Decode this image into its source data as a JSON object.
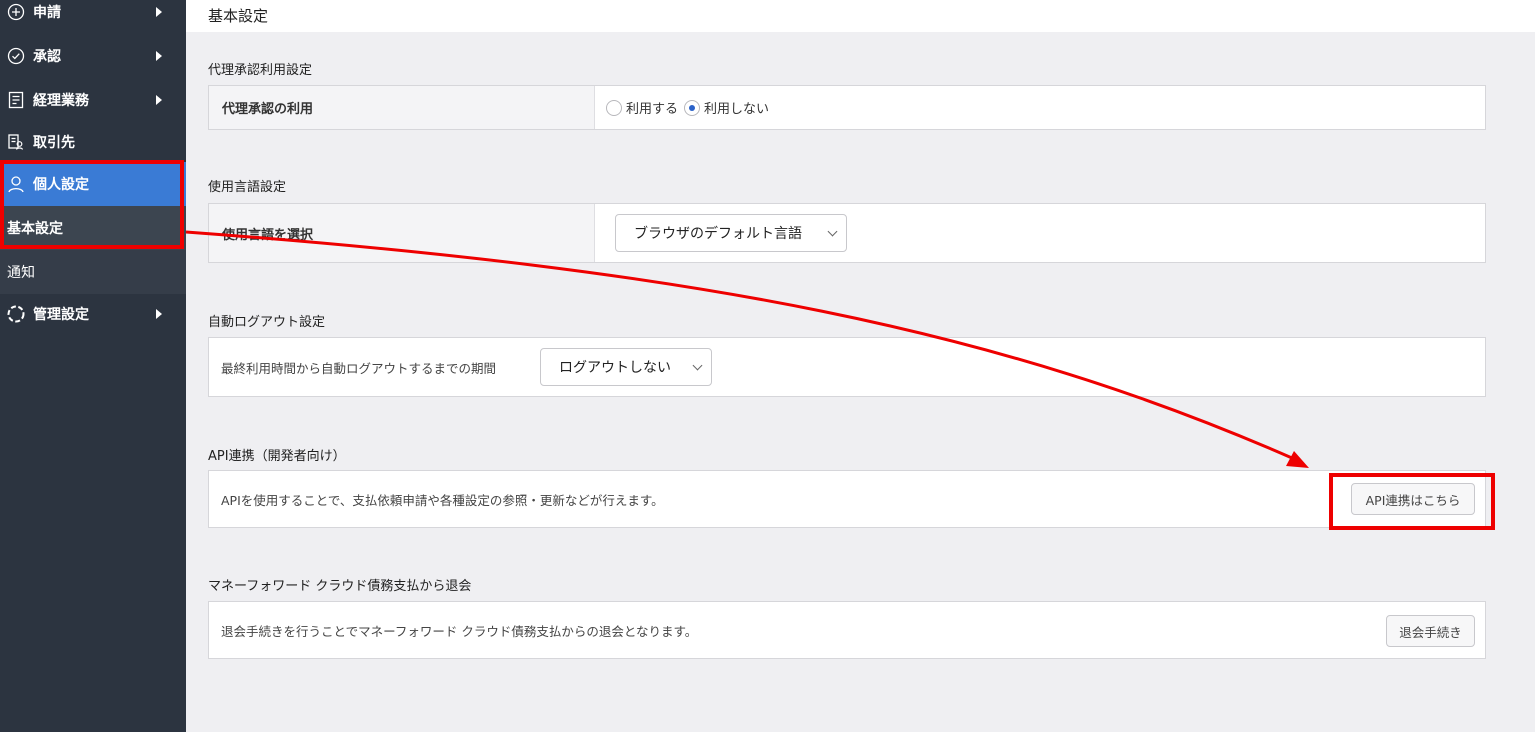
{
  "sidebar": {
    "items": [
      {
        "label": "申請",
        "icon": "plus-circle-icon"
      },
      {
        "label": "承認",
        "icon": "check-circle-icon"
      },
      {
        "label": "経理業務",
        "icon": "document-list-icon"
      },
      {
        "label": "取引先",
        "icon": "vendor-icon"
      },
      {
        "label": "個人設定",
        "icon": "user-icon"
      },
      {
        "label": "管理設定",
        "icon": "gear-icon"
      }
    ],
    "sub_items": [
      {
        "label": "基本設定"
      },
      {
        "label": "通知"
      }
    ]
  },
  "header": {
    "title": "基本設定"
  },
  "sections": {
    "proxy": {
      "title": "代理承認利用設定",
      "row_label": "代理承認の利用",
      "option_use": "利用する",
      "option_not_use": "利用しない",
      "selected": "利用しない"
    },
    "language": {
      "title": "使用言語設定",
      "row_label": "使用言語を選択",
      "selected_value": "ブラウザのデフォルト言語"
    },
    "logout": {
      "title": "自動ログアウト設定",
      "description": "最終利用時間から自動ログアウトするまでの期間",
      "selected_value": "ログアウトしない"
    },
    "api": {
      "title": "API連携（開発者向け）",
      "description": "APIを使用することで、支払依頼申請や各種設定の参照・更新などが行えます。",
      "button_label": "API連携はこちら"
    },
    "withdraw": {
      "title": "マネーフォワード クラウド債務支払から退会",
      "description": "退会手続きを行うことでマネーフォワード クラウド債務支払からの退会となります。",
      "button_label": "退会手続き"
    }
  },
  "colors": {
    "sidebar_bg": "#2c3440",
    "active_blue": "#3a7bd5",
    "annotation_red": "#ee0000"
  }
}
